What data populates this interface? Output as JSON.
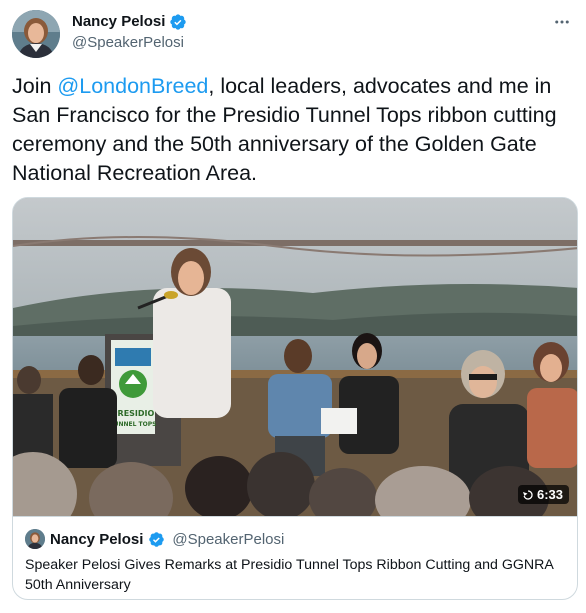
{
  "tweet": {
    "author": {
      "name": "Nancy Pelosi",
      "handle": "@SpeakerPelosi",
      "verified": true,
      "avatar_icon": "profile-photo"
    },
    "more_icon": "ellipsis-icon",
    "text": {
      "prefix": "Join ",
      "mention": "@LondonBreed",
      "suffix": ", local leaders, advocates and me in San Francisco for the Presidio Tunnel Tops ribbon cutting ceremony and the 50th anniversary of the Golden Gate National Recreation Area."
    },
    "media": {
      "duration": "6:33",
      "podium_sign": [
        "PRESIDIO",
        "TUNNEL TOPS"
      ]
    },
    "quoted": {
      "name": "Nancy Pelosi",
      "handle": "@SpeakerPelosi",
      "title": "Speaker Pelosi Gives Remarks at Presidio Tunnel Tops Ribbon Cutting and GGNRA 50th Anniversary"
    }
  },
  "colors": {
    "link": "#1d9bf0",
    "verified": "#1d9bf0",
    "secondary_text": "#536471",
    "border": "#cfd9de"
  }
}
